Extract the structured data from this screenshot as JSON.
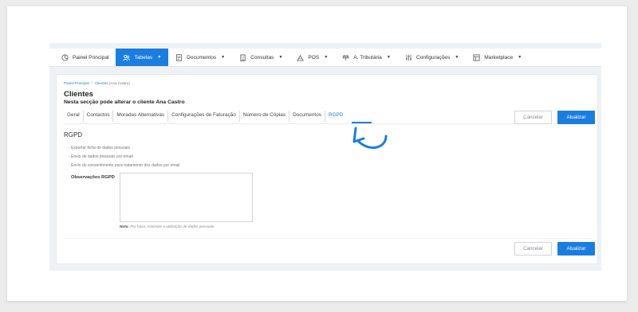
{
  "navbar": {
    "items": [
      {
        "label": "Painel Principal",
        "icon": "dashboard-icon",
        "dropdown": false,
        "active": false
      },
      {
        "label": "Tabelas",
        "icon": "users-icon",
        "dropdown": true,
        "active": true
      },
      {
        "label": "Documentos",
        "icon": "document-icon",
        "dropdown": true,
        "active": false
      },
      {
        "label": "Consultas",
        "icon": "building-icon",
        "dropdown": true,
        "active": false
      },
      {
        "label": "POS",
        "icon": "pos-icon",
        "dropdown": true,
        "active": false
      },
      {
        "label": "A. Tributária",
        "icon": "tax-icon",
        "dropdown": true,
        "active": false
      },
      {
        "label": "Configurações",
        "icon": "sliders-icon",
        "dropdown": true,
        "active": false
      },
      {
        "label": "Marketplace",
        "icon": "marketplace-icon",
        "dropdown": true,
        "active": false
      }
    ]
  },
  "breadcrumb": {
    "home": "Painel Principal",
    "section": "Clientes",
    "current": "(Ana Castro)"
  },
  "page": {
    "title": "Clientes",
    "subtitle": "Nesta secção pode alterar o cliente Ana Castro"
  },
  "tabs": [
    "Geral",
    "Contactos",
    "Moradas Alternativas",
    "Configurações de Faturação",
    "Número de Cópias",
    "Documentos",
    "RGPD"
  ],
  "active_tab": "RGPD",
  "buttons": {
    "cancel": "Cancelar",
    "update": "Atualizar"
  },
  "rgpd": {
    "title": "RGPD",
    "items": [
      "- Exportar ficha de dados pessoais",
      "- Envio de dados pessoais por email",
      "- Envio do consentimento para tratamento dos dados por email"
    ],
    "observacoes_label": "Observações RGPD",
    "observacoes_value": "",
    "note_prefix": "Nota:",
    "note_text": "Por favor, minimize a utilização de dados pessoais."
  },
  "colors": {
    "accent": "#1a7de0",
    "annotation_arrow": "#1a7de0"
  }
}
